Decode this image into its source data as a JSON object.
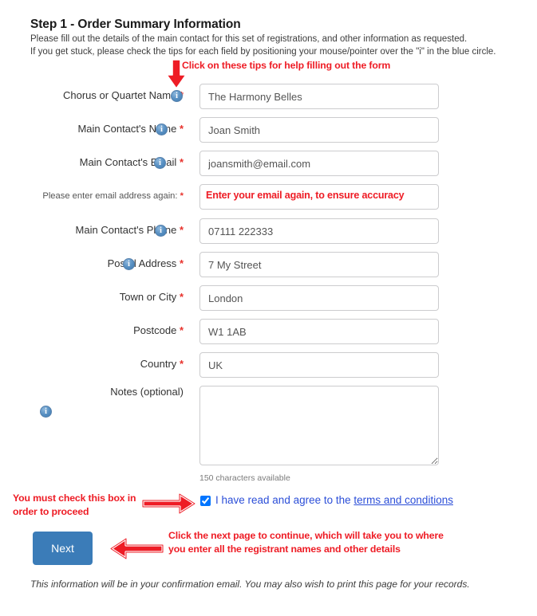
{
  "header": {
    "title": "Step 1 - Order Summary Information",
    "line1": "Please fill out the details of the main contact for this set of registrations, and other information as requested.",
    "line2": "If you get stuck, please check the tips for each field by positioning your mouse/pointer over the \"i\" in the blue circle."
  },
  "annotations": {
    "tips": "Click on these tips for help filling out the form",
    "checkbox": "You must check this box in order to proceed",
    "next": "Click the next page to continue, which will take you to where you enter all the registrant names and other details",
    "confirm_email": "Enter your email again, to ensure accuracy"
  },
  "form": {
    "fields": [
      {
        "label": "Chorus or Quartet Name",
        "required": true,
        "info": true,
        "value": "The Harmony Belles",
        "placeholder": ""
      },
      {
        "label": "Main Contact's Name",
        "required": true,
        "info": true,
        "value": "Joan Smith",
        "placeholder": ""
      },
      {
        "label": "Main Contact's Email",
        "required": true,
        "info": true,
        "value": "joansmith@email.com",
        "placeholder": ""
      },
      {
        "label": "Please enter email address again:",
        "required": true,
        "info": false,
        "value": "",
        "placeholder": ""
      },
      {
        "label": "Main Contact's Phone",
        "required": true,
        "info": true,
        "value": "07111 222333",
        "placeholder": ""
      },
      {
        "label": "Postal Address",
        "required": true,
        "info": true,
        "value": "7 My Street",
        "placeholder": ""
      },
      {
        "label": "Town or City",
        "required": true,
        "info": false,
        "value": "London",
        "placeholder": ""
      },
      {
        "label": "Postcode",
        "required": true,
        "info": false,
        "value": "W1 1AB",
        "placeholder": ""
      },
      {
        "label": "Country",
        "required": true,
        "info": false,
        "value": "UK",
        "placeholder": ""
      }
    ],
    "notes": {
      "label": "Notes (optional)",
      "info": true,
      "value": "",
      "placeholder": "",
      "char_count": "150 characters available"
    },
    "required_marker": "*",
    "info_icon_glyph": "i"
  },
  "terms": {
    "checked": true,
    "text_before": "I have read and agree to the ",
    "link_text": "terms and conditions"
  },
  "actions": {
    "next_label": "Next"
  },
  "footer": {
    "text": "This information will be in your confirmation email. You may also wish to print this page for your records."
  },
  "colors": {
    "annotation_red": "#ee1c25",
    "required_red": "#e8322c",
    "button_blue": "#3b7cb8",
    "link_blue": "#2b4ed8",
    "info_icon_blue": "#5b92c4"
  }
}
